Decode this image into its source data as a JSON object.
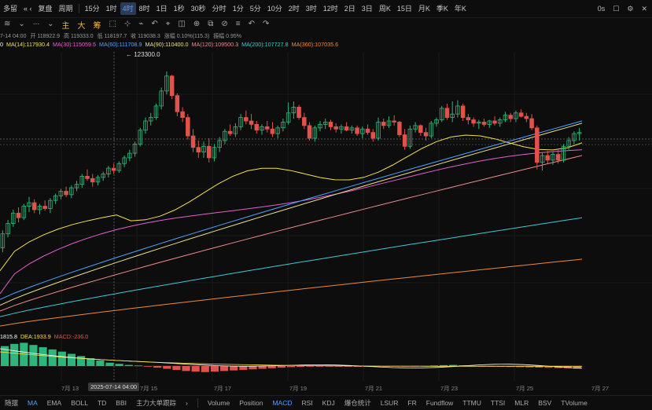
{
  "topbar": {
    "left_label": "多留",
    "back_label": "« ‹",
    "review_label": "复盘",
    "period_label": "周期",
    "intervals": [
      "15分",
      "1时",
      "4时",
      "8时",
      "1日",
      "1秒",
      "30秒",
      "分时",
      "1分",
      "5分",
      "10分",
      "2时",
      "3时",
      "12时",
      "2日",
      "3日",
      "周K",
      "15日",
      "月K",
      "季K",
      "年K"
    ],
    "active_interval": "4时",
    "right_items": [
      "0s",
      "☐",
      "⚙",
      "✕"
    ]
  },
  "toolbar": {
    "items": [
      "≋",
      "⌄",
      "∙∙∙",
      "⌄"
    ],
    "zh_items": [
      "主",
      "大",
      "筹"
    ],
    "tools": [
      "⬚",
      "⊹",
      "⌁",
      "↶",
      "⌖",
      "◫",
      "⊕",
      "⧉",
      "⊘",
      "≡",
      "↶",
      "↷"
    ]
  },
  "ohlc": {
    "time": "7-14 04:00",
    "open": "开 118922.9",
    "high": "高 119333.0",
    "low": "低 118197.7",
    "close": "收 119038.3",
    "change": "涨幅 0.10%(115.3)",
    "amplitude": "振幅 0.95%"
  },
  "ma_labels": [
    {
      "text": "0",
      "color": "#ffffff"
    },
    {
      "text": "MA(14):117930.4",
      "color": "#f5e24a"
    },
    {
      "text": "MA(30):115059.5",
      "color": "#e45fd1"
    },
    {
      "text": "MA(60):111708.9",
      "color": "#4ea1ff"
    },
    {
      "text": "MA(90):110400.0",
      "color": "#e8e08a"
    },
    {
      "text": "MA(120):109500.3",
      "color": "#ef8a8a"
    },
    {
      "text": "MA(200):107727.8",
      "color": "#3ecad4"
    },
    {
      "text": "MA(360):107035.6",
      "color": "#f08a3a"
    }
  ],
  "peak_label": "← 123300.0",
  "macd_labels": [
    {
      "text": "1815.8",
      "color": "#ffffff"
    },
    {
      "text": "DEA:1933.9",
      "color": "#f5e24a"
    },
    {
      "text": "MACD:-236.0",
      "color": "#e0524a"
    }
  ],
  "x_axis": {
    "ticks": [
      "7月 13",
      "7月 15",
      "7月 17",
      "7月 19",
      "7月 21",
      "7月 23",
      "7月 25",
      "7月 27"
    ],
    "cursor_date": "2025-07-14 04:00"
  },
  "bottombar": {
    "left": [
      "随摆",
      "MA",
      "EMA",
      "BOLL",
      "TD",
      "BBI",
      "主力大单跟踪",
      "›"
    ],
    "right": [
      "Volume",
      "Position",
      "MACD",
      "RSI",
      "KDJ",
      "爆仓统计",
      "LSUR",
      "FR",
      "Fundflow",
      "TTMU",
      "TTSI",
      "MLR",
      "BSV",
      "TVolume"
    ],
    "active_left": "MA",
    "active_right": "MACD"
  },
  "colors": {
    "up": "#2db67c",
    "down": "#e0524a",
    "background": "#0d0d0d",
    "accent": "#4ea1ff"
  },
  "chart_data": {
    "type": "candlestick",
    "candles_ohlc": [
      [
        108000,
        109500,
        107600,
        109200
      ],
      [
        109200,
        110400,
        108900,
        110100
      ],
      [
        110100,
        111300,
        109800,
        111000
      ],
      [
        111000,
        111500,
        110200,
        110600
      ],
      [
        110600,
        111800,
        110400,
        111600
      ],
      [
        111600,
        112400,
        111100,
        111900
      ],
      [
        111900,
        112200,
        111000,
        111300
      ],
      [
        111300,
        111800,
        110900,
        111600
      ],
      [
        111600,
        112100,
        111200,
        111400
      ],
      [
        111400,
        112300,
        111000,
        112100
      ],
      [
        112100,
        112700,
        111800,
        112500
      ],
      [
        112500,
        113100,
        112200,
        112900
      ],
      [
        112900,
        113300,
        112400,
        112600
      ],
      [
        112600,
        113400,
        112300,
        113200
      ],
      [
        113200,
        113800,
        112900,
        113500
      ],
      [
        113500,
        114400,
        113200,
        114200
      ],
      [
        114200,
        114800,
        113800,
        114000
      ],
      [
        114000,
        114400,
        113300,
        113700
      ],
      [
        113700,
        114300,
        113400,
        114100
      ],
      [
        114100,
        114600,
        113800,
        114400
      ],
      [
        114400,
        115100,
        114100,
        114900
      ],
      [
        114900,
        115300,
        114400,
        114700
      ],
      [
        114700,
        115500,
        114500,
        115300
      ],
      [
        115300,
        116000,
        115000,
        115800
      ],
      [
        115800,
        116500,
        115500,
        116200
      ],
      [
        116200,
        117200,
        115900,
        117000
      ],
      [
        117000,
        118400,
        116800,
        118200
      ],
      [
        118200,
        119300,
        117900,
        119000
      ],
      [
        119000,
        119700,
        118600,
        119300
      ],
      [
        119300,
        120500,
        119100,
        120300
      ],
      [
        120300,
        121900,
        120000,
        121600
      ],
      [
        121600,
        123300,
        121300,
        122900
      ],
      [
        122900,
        123000,
        120900,
        121200
      ],
      [
        121200,
        121400,
        119400,
        119800
      ],
      [
        119800,
        120200,
        118900,
        119300
      ],
      [
        119300,
        119600,
        117400,
        117700
      ],
      [
        117700,
        118300,
        116300,
        116700
      ],
      [
        116700,
        117300,
        115800,
        116300
      ],
      [
        116300,
        117200,
        115800,
        116800
      ],
      [
        116800,
        117500,
        115400,
        115800
      ],
      [
        115800,
        117000,
        115500,
        116700
      ],
      [
        116700,
        117600,
        116300,
        117300
      ],
      [
        117300,
        118300,
        117000,
        118100
      ],
      [
        118100,
        118700,
        117700,
        117900
      ],
      [
        117900,
        118800,
        117600,
        118500
      ],
      [
        118500,
        119600,
        118200,
        119300
      ],
      [
        119300,
        119900,
        118700,
        119000
      ],
      [
        119000,
        119600,
        118300,
        118700
      ],
      [
        118700,
        119000,
        117900,
        118200
      ],
      [
        118200,
        118700,
        117800,
        118500
      ],
      [
        118500,
        119000,
        118000,
        118300
      ],
      [
        118300,
        118900,
        117600,
        117900
      ],
      [
        117900,
        118600,
        117500,
        118400
      ],
      [
        118400,
        119200,
        118100,
        118900
      ],
      [
        118900,
        120600,
        118700,
        119700
      ],
      [
        119700,
        120700,
        119200,
        120200
      ],
      [
        120200,
        120400,
        119100,
        119300
      ],
      [
        119300,
        119700,
        118300,
        118600
      ],
      [
        118600,
        118900,
        117300,
        117500
      ],
      [
        117500,
        118600,
        117200,
        118400
      ],
      [
        118400,
        119000,
        118100,
        118700
      ],
      [
        118700,
        119200,
        118300,
        118900
      ],
      [
        118900,
        119100,
        118200,
        118500
      ],
      [
        118500,
        118800,
        118000,
        118300
      ],
      [
        118300,
        118700,
        117900,
        118500
      ],
      [
        118500,
        118900,
        118100,
        118200
      ],
      [
        118200,
        118600,
        117900,
        118400
      ],
      [
        118400,
        118600,
        117700,
        117900
      ],
      [
        117900,
        118500,
        117500,
        118300
      ],
      [
        118300,
        118700,
        117800,
        118000
      ],
      [
        118000,
        118300,
        117200,
        117500
      ],
      [
        117500,
        119300,
        117300,
        118900
      ],
      [
        118900,
        119200,
        118300,
        118600
      ],
      [
        118600,
        119400,
        118400,
        119000
      ],
      [
        119000,
        119500,
        118600,
        118900
      ],
      [
        118900,
        119000,
        117600,
        117800
      ],
      [
        117800,
        118300,
        116500,
        116800
      ],
      [
        116800,
        118600,
        116600,
        118300
      ],
      [
        118300,
        118900,
        118000,
        118600
      ],
      [
        118600,
        118700,
        117700,
        118000
      ],
      [
        118000,
        118400,
        117300,
        117700
      ],
      [
        117700,
        119000,
        117500,
        118800
      ],
      [
        118800,
        119300,
        118500,
        119100
      ],
      [
        119100,
        120300,
        118900,
        120100
      ],
      [
        120100,
        120500,
        119100,
        119300
      ],
      [
        119300,
        120700,
        118900,
        119600
      ],
      [
        119600,
        120800,
        119300,
        120300
      ],
      [
        120300,
        120500,
        119000,
        119300
      ],
      [
        119300,
        119600,
        118700,
        119100
      ],
      [
        119100,
        119300,
        118500,
        118800
      ],
      [
        118800,
        119100,
        118300,
        118900
      ],
      [
        118900,
        119200,
        118500,
        118700
      ],
      [
        118700,
        119100,
        118400,
        119000
      ],
      [
        119000,
        119400,
        118600,
        118800
      ],
      [
        118800,
        119300,
        118500,
        119100
      ],
      [
        119100,
        119800,
        118900,
        119500
      ],
      [
        119500,
        119700,
        118900,
        119200
      ],
      [
        119200,
        119900,
        118900,
        119700
      ],
      [
        119700,
        120000,
        119300,
        119400
      ],
      [
        119400,
        119700,
        118900,
        119200
      ],
      [
        119200,
        119600,
        118200,
        118400
      ],
      [
        118400,
        118600,
        114800,
        115400
      ],
      [
        115400,
        116300,
        114700,
        116000
      ],
      [
        116000,
        116400,
        115300,
        115600
      ],
      [
        115600,
        116300,
        115200,
        116100
      ],
      [
        116100,
        116500,
        115300,
        115600
      ],
      [
        115600,
        117000,
        115400,
        116800
      ],
      [
        116800,
        117600,
        116500,
        117300
      ],
      [
        117300,
        118100,
        117000,
        117900
      ],
      [
        117900,
        118400,
        117300,
        118000
      ]
    ],
    "y_range": [
      101000,
      125000
    ],
    "ma_lines": [
      {
        "name": "MA(14)",
        "color": "#f5e24a",
        "start": 106000,
        "end": 118000
      },
      {
        "name": "MA(30)",
        "color": "#e45fd1",
        "start": 104000,
        "end": 116300
      },
      {
        "name": "MA(60)",
        "color": "#4ea1ff",
        "start": 103500,
        "end": 119000
      },
      {
        "name": "MA(90)",
        "color": "#e8e08a",
        "start": 103000,
        "end": 118800
      },
      {
        "name": "MA(120)",
        "color": "#ef8a8a",
        "start": 102500,
        "end": 116000
      },
      {
        "name": "MA(200)",
        "color": "#3ecad4",
        "start": 102000,
        "end": 110600
      },
      {
        "name": "MA(360)",
        "color": "#f08a3a",
        "start": 101200,
        "end": 107000
      }
    ],
    "macd_hist": [
      1800,
      2000,
      2100,
      1900,
      1700,
      1500,
      1300,
      1100,
      900,
      700,
      500,
      300,
      200,
      100,
      50,
      -50,
      -150,
      -250,
      -350,
      -450,
      -500,
      -550,
      -500,
      -450,
      -400,
      -350,
      -300,
      -250,
      -200,
      -150,
      -100,
      -80,
      -60,
      -60,
      -50,
      -50,
      -60,
      -70,
      -60,
      -50,
      -40,
      -30,
      -20,
      -10,
      0,
      50,
      80,
      100,
      60,
      20,
      -20,
      -40,
      -60,
      -80,
      -100,
      -120,
      -140,
      -160,
      -180,
      -200,
      -236
    ]
  }
}
